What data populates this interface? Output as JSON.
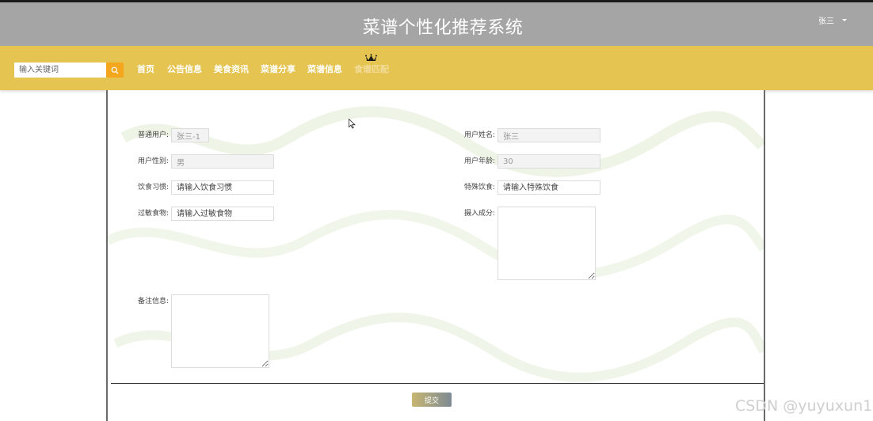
{
  "header": {
    "site_title": "菜谱个性化推荐系统",
    "username": "张三",
    "caret_icon": "caret-down-icon"
  },
  "navbar": {
    "search": {
      "placeholder": "输入关键词",
      "value": "",
      "icon": "search-icon"
    },
    "items": [
      {
        "label": "首页"
      },
      {
        "label": "公告信息"
      },
      {
        "label": "美食资讯"
      },
      {
        "label": "菜谱分享"
      },
      {
        "label": "菜谱信息"
      },
      {
        "label": "食谱匹配",
        "active": true,
        "icon": "crown-icon"
      }
    ]
  },
  "form": {
    "account": {
      "label": "普通用户:",
      "value": "张三-1"
    },
    "name": {
      "label": "用户姓名:",
      "value": "张三"
    },
    "gender": {
      "label": "用户性别:",
      "value": "男"
    },
    "age": {
      "label": "用户年龄:",
      "value": "30"
    },
    "diet_habit": {
      "label": "饮食习惯:",
      "placeholder": "请输入饮食习惯",
      "value": ""
    },
    "special_diet": {
      "label": "特殊饮食:",
      "placeholder": "请输入特殊饮食",
      "value": ""
    },
    "allergy": {
      "label": "过敏食物:",
      "placeholder": "请输入过敏食物",
      "value": ""
    },
    "intake": {
      "label": "摄入成分:",
      "value": ""
    },
    "remark": {
      "label": "备注信息:",
      "value": ""
    },
    "submit_label": "提交"
  },
  "watermark": "CSDN @yuyuxun1",
  "colors": {
    "topbar": "#a5a5a5",
    "navbar": "#e6c451",
    "search_button": "#f4a71d",
    "active_nav": "#f2dc9a"
  }
}
